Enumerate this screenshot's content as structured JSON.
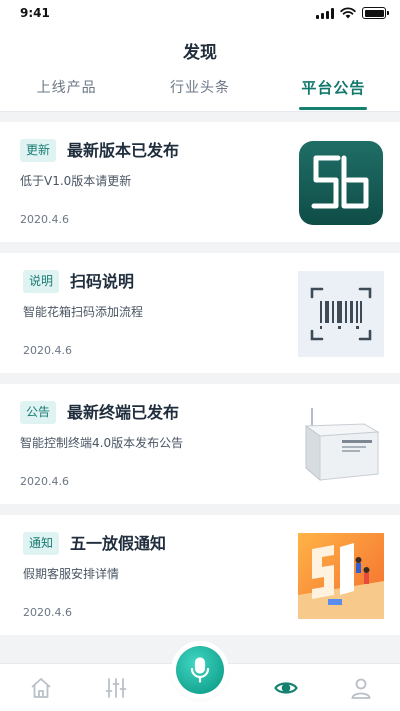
{
  "status_bar": {
    "time": "9:41"
  },
  "header": {
    "title": "发现"
  },
  "tabs": [
    {
      "label": "上线产品",
      "active": false
    },
    {
      "label": "行业头条",
      "active": false
    },
    {
      "label": "平台公告",
      "active": true
    }
  ],
  "cards": [
    {
      "tag": "更新",
      "title": "最新版本已发布",
      "desc": "低于V1.0版本请更新",
      "date": "2020.4.6",
      "thumb_icon": "app-logo-icon"
    },
    {
      "tag": "说明",
      "title": "扫码说明",
      "desc": "智能花箱扫码添加流程",
      "date": "2020.4.6",
      "thumb_icon": "barcode-scan-icon"
    },
    {
      "tag": "公告",
      "title": "最新终端已发布",
      "desc": "智能控制终端4.0版本发布公告",
      "date": "2020.4.6",
      "thumb_icon": "terminal-device-image"
    },
    {
      "tag": "通知",
      "title": "五一放假通知",
      "desc": "假期客服安排详情",
      "date": "2020.4.6",
      "thumb_icon": "holiday-illustration"
    }
  ],
  "bottom_nav": {
    "items": [
      "home-icon",
      "sliders-icon",
      "microphone-icon",
      "eye-icon",
      "user-icon"
    ],
    "active": "eye-icon"
  },
  "colors": {
    "accent": "#14806f",
    "tag_bg": "#dff3f2",
    "page_bg": "#f2f3f5"
  }
}
